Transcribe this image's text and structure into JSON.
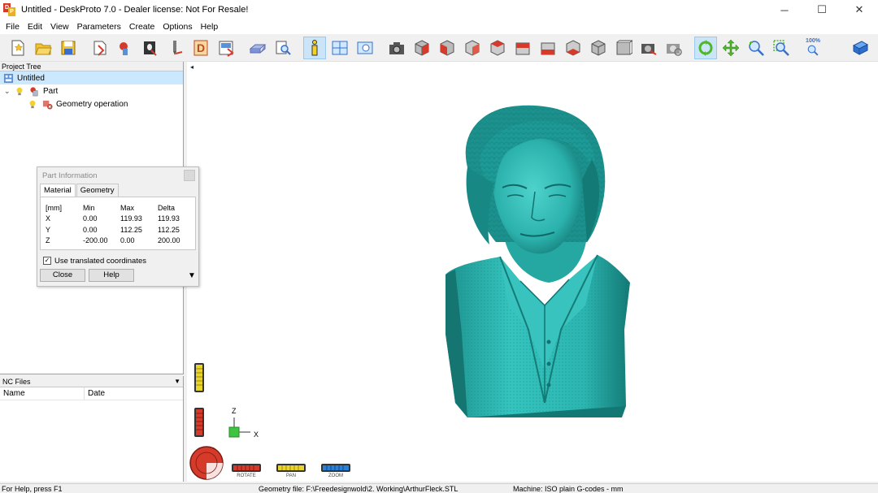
{
  "window": {
    "title": "Untitled - DeskProto 7.0 - Dealer license: Not For Resale!",
    "minimize": "─",
    "maximize": "☐",
    "close": "✕",
    "icon_letters": [
      "D",
      "P"
    ]
  },
  "menu": [
    "File",
    "Edit",
    "View",
    "Parameters",
    "Create",
    "Options",
    "Help"
  ],
  "project_tree": {
    "header": "Project Tree",
    "items": [
      {
        "label": "Untitled",
        "level": 0
      },
      {
        "label": "Part",
        "level": 1
      },
      {
        "label": "Geometry operation",
        "level": 2
      }
    ]
  },
  "part_information": {
    "title": "Part Information",
    "tabs": [
      "Material",
      "Geometry"
    ],
    "active_tab": "Material",
    "headers": [
      "[mm]",
      "Min",
      "Max",
      "Delta"
    ],
    "rows": [
      [
        "X",
        "0.00",
        "119.93",
        "119.93"
      ],
      [
        "Y",
        "0.00",
        "112.25",
        "112.25"
      ],
      [
        "Z",
        "-200.00",
        "0.00",
        "200.00"
      ]
    ],
    "checkbox_label": "Use translated coordinates",
    "checkbox_checked": "✓",
    "close_button": "Close",
    "help_button": "Help",
    "more_arrow": "▼"
  },
  "nc_files": {
    "header": "NC Files",
    "dropdown_arrow": "▼",
    "columns": [
      "Name",
      "Date"
    ]
  },
  "toolbar": {
    "zoom_label": "100%"
  },
  "axes": {
    "z": "Z",
    "x": "X"
  },
  "view_controls": {
    "rotate": "ROTATE",
    "pan": "PAN",
    "zoom": "ZOOM"
  },
  "status": {
    "help": "For Help, press F1",
    "geometry_file": "Geometry file: F:\\Freedesignwold\\2. Working\\ArthurFleck.STL",
    "machine": "Machine: ISO plain G-codes - mm"
  },
  "colors": {
    "model": "#2fbdb8",
    "model_shadow": "#15807c",
    "selection": "#cce8ff",
    "rotate": "#d63a2a",
    "pan": "#e8d42a",
    "zoom": "#2a7fd6"
  },
  "collapse_arrow": "◂"
}
